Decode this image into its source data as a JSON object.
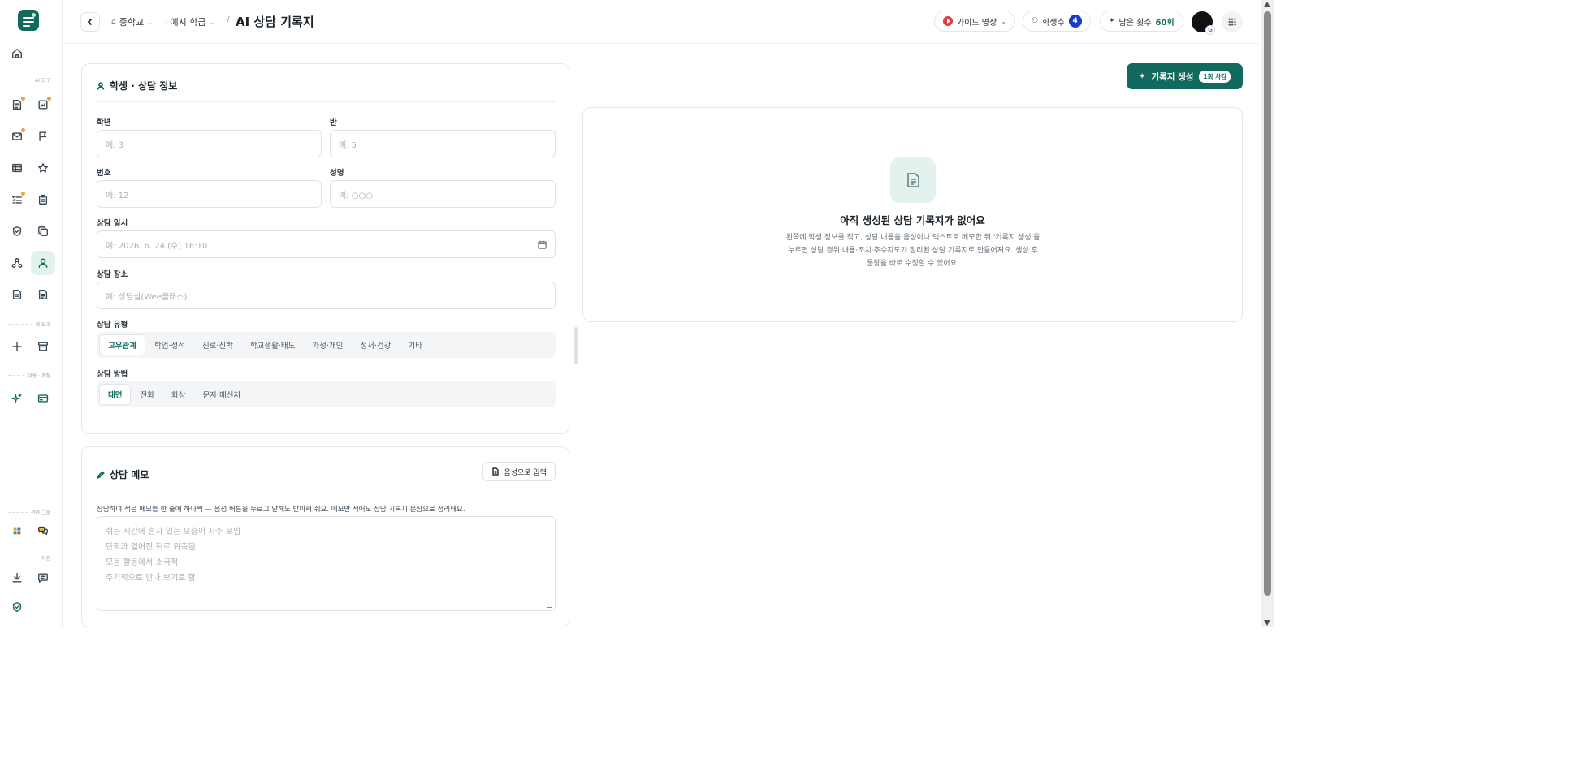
{
  "sidebar": {
    "sections": {
      "ai_tools": "AI 도구",
      "my_tools": "내 도구",
      "billing": "이용 · 계정",
      "related_apps": "관련 그룹",
      "support": "지원"
    }
  },
  "header": {
    "school": "중학교",
    "class": "예시 학급",
    "title": "AI 상담 기록지",
    "guide_video": "가이드 영상",
    "students_label": "학생수",
    "students_count": "4",
    "remaining_label": "남은 횟수",
    "remaining_value": "60회"
  },
  "student_card": {
    "title": "학생 · 상담 정보",
    "grade_label": "학년",
    "grade_placeholder": "예: 3",
    "class_label": "반",
    "class_placeholder": "예: 5",
    "number_label": "번호",
    "number_placeholder": "예: 12",
    "name_label": "성명",
    "name_placeholder": "예: ○○○",
    "datetime_label": "상담 일시",
    "datetime_placeholder": "예: 2026. 6. 24.(수) 16:10",
    "place_label": "상담 장소",
    "place_placeholder": "예: 상담실(Wee클래스)",
    "type_label": "상담 유형",
    "types": [
      "교우관계",
      "학업·성적",
      "진로·진학",
      "학교생활·태도",
      "가정·개인",
      "정서·건강",
      "기타"
    ],
    "type_selected": "교우관계",
    "method_label": "상담 방법",
    "methods": [
      "대면",
      "전화",
      "화상",
      "문자·메신저"
    ],
    "method_selected": "대면"
  },
  "memo_card": {
    "title": "상담 메모",
    "voice_button": "음성으로 입력",
    "description": "상담하며 적은 메모를 한 줄에 하나씩 — 음성 버튼을 누르고 말해도 받아써 줘요. 메모만 적어도 상담 기록지 문장으로 정리돼요.",
    "placeholder_lines": [
      "쉬는 시간에 혼자 있는 모습이 자주 보임",
      "단짝과 멀어진 뒤로 위축됨",
      "모둠 활동에서 소극적",
      "주기적으로 만나 보기로 함"
    ]
  },
  "generate": {
    "label": "기록지 생성",
    "badge": "1회 차감"
  },
  "empty_state": {
    "title": "아직 생성된 상담 기록지가 없어요",
    "line1": "왼쪽에 학생 정보를 적고, 상담 내용을 음성이나 텍스트로 메모한 뒤 '기록지 생성'을",
    "line2": "누르면 상담 경위·내용·조치·추수지도가 정리된 상담 기록지로 만들어져요. 생성 후",
    "line3": "문장을 바로 수정할 수 있어요."
  },
  "colors": {
    "brand": "#12695e",
    "badge_blue": "#1b39c9",
    "notification": "#f0a13a"
  }
}
